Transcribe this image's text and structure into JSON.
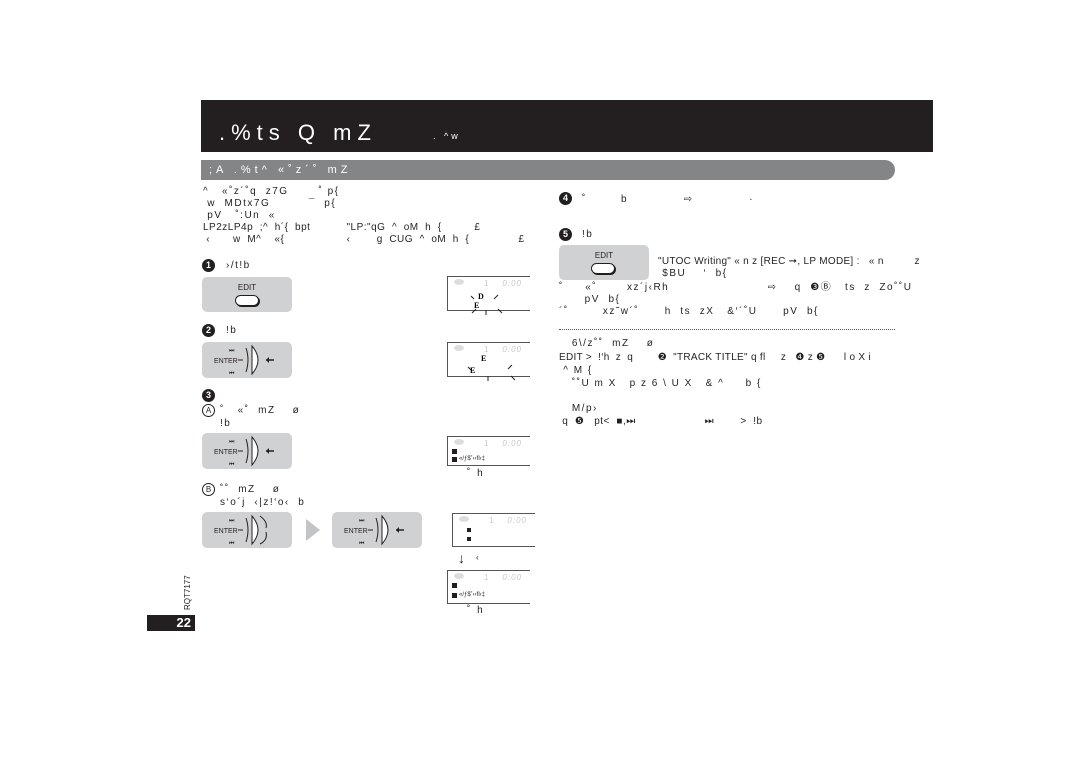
{
  "header": {
    "title": ".%ts Q mZ",
    "subtitle": ". ^w"
  },
  "section": {
    "title": ";A .%t^  «˚z´˚ mZ"
  },
  "intro": {
    "lines": [
      "^   «˚z´˚q  z7G       ˚ p{",
      " w  MDtx7G         ¯  p{",
      " pV   ˚:Un  «",
      "LP2zLP4p  ;^  h´{  bpt           \"LP:\"qG  ^  oM  h  {          £",
      " ‹       w  M^    «{                   ‹        g  CUG  ^  oM  h  {               £"
    ]
  },
  "steps": {
    "s1": {
      "num": "1",
      "label": "›/t!b",
      "button": "EDIT"
    },
    "s2": {
      "num": "2",
      "label": "!b",
      "button": "ENTER"
    },
    "s3": {
      "num": "3",
      "a": {
        "letter": "A",
        "label": "˚   «˚  mZ    ø",
        "sub": "!b",
        "button": "ENTER",
        "caption": "˚     h"
      },
      "b": {
        "letter": "B",
        "label": "˚˚  mZ    ø",
        "sub": "s‘o´j  ‹|z!‘o‹  b",
        "button": "ENTER",
        "caption_mid": "‹",
        "caption": "˚     h"
      }
    },
    "s4": {
      "num": "4",
      "label": "˚        b             ⇨             ·"
    },
    "s5": {
      "num": "5",
      "label": "!b",
      "button": "EDIT",
      "note1": "\"UTOC Writing\" « n z [REC ➞, LP MODE] :   « n          z",
      "note2": " $BU    ‘  b{",
      "lines": [
        "˚     «˚       xz´j‹Rh                       ⇨    q  ❸Ⓑ   ts  z  Zo˚˚U",
        "      pV  b{",
        "´˚        xz˜w´˚      h  ts  zX   &‘´˚U      pV  b{"
      ]
    }
  },
  "notes": {
    "heading": "   6\\/z˚˚  mZ    ø",
    "lines": [
      "EDIT >  !‘h  z  q        ❷  \"TRACK TITLE\" q fl     z   ❹ z ❺      l o X i",
      " ^ M {",
      "   ˚˚U m X   p z 6 \\ U X   & ^     b {"
    ],
    "heading2": "   M/p›",
    "line2": " q  ❺   pt<  ■,⏭                     ⏭        >  !b"
  },
  "lcd": {
    "time": "0:00",
    "track": "1",
    "title_text": "«/ƒ$˚‹‹fl‹‡"
  },
  "footer": {
    "page": "22",
    "code": "RQT7177"
  }
}
